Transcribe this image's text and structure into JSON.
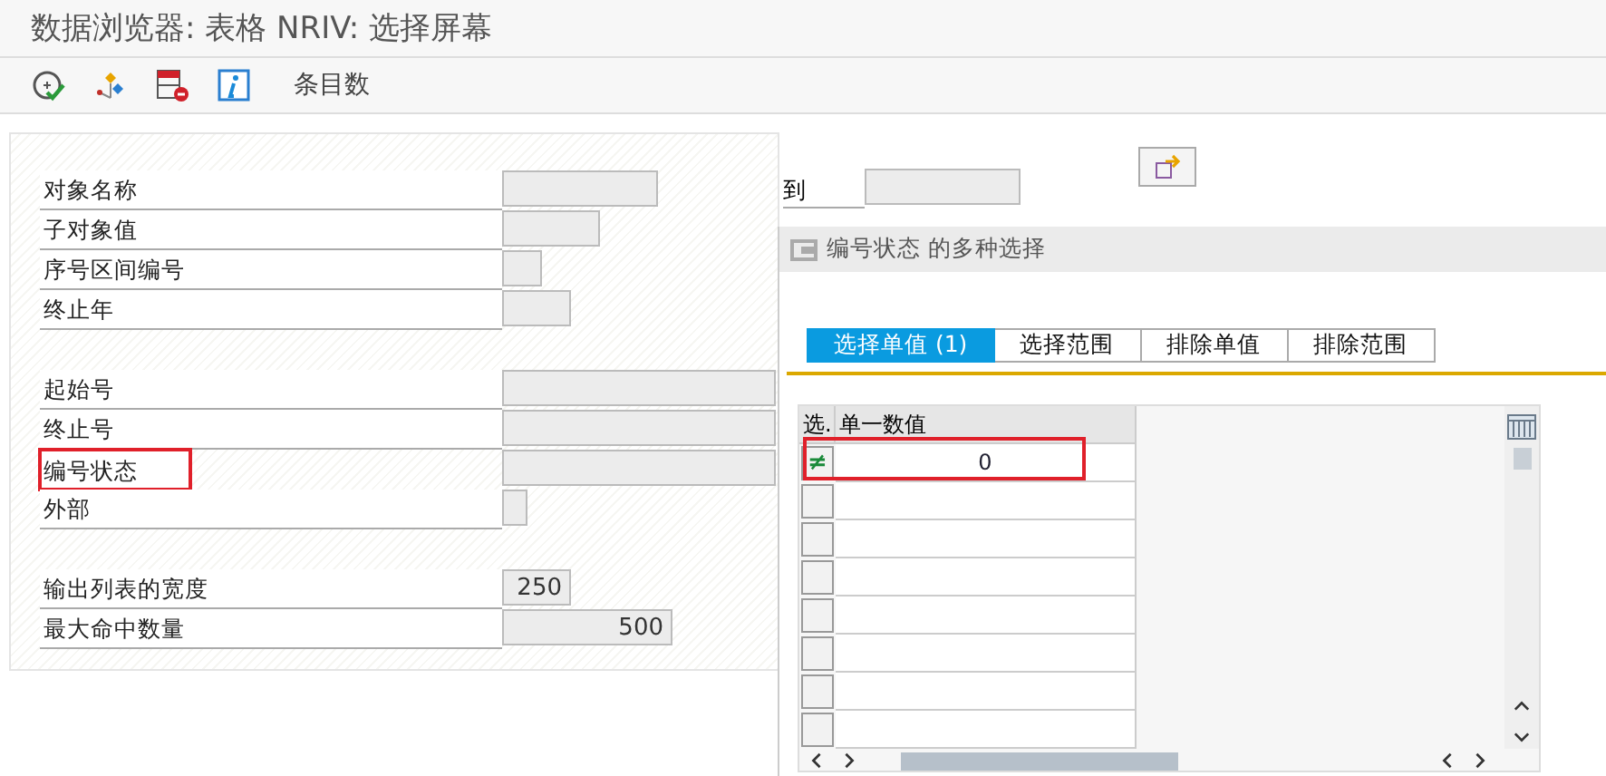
{
  "window": {
    "title": "数据浏览器: 表格 NRIV: 选择屏幕"
  },
  "toolbar": {
    "icons": [
      {
        "kind": "execute"
      },
      {
        "kind": "structure"
      },
      {
        "kind": "delete"
      },
      {
        "kind": "info"
      }
    ],
    "count_button": "条目数"
  },
  "form": {
    "groups": [
      [
        {
          "label": "对象名称",
          "highlighted": false
        },
        {
          "label": "子对象值",
          "highlighted": false
        },
        {
          "label": "序号区间编号",
          "highlighted": false
        },
        {
          "label": "终止年",
          "highlighted": false
        }
      ],
      [
        {
          "label": "起始号",
          "highlighted": false
        },
        {
          "label": "终止号",
          "highlighted": false
        },
        {
          "label": "编号状态",
          "highlighted": true
        },
        {
          "label": "外部",
          "highlighted": false
        }
      ],
      [
        {
          "label": "输出列表的宽度",
          "value": "250",
          "highlighted": false
        },
        {
          "label": "最大命中数量",
          "value": "500",
          "highlighted": false
        }
      ]
    ],
    "range_label": "到"
  },
  "dialog": {
    "title": "编号状态 的多种选择",
    "tabs": [
      {
        "label": "选择单值 (1)",
        "selected": true
      },
      {
        "label": "选择范围",
        "selected": false
      },
      {
        "label": "排除单值",
        "selected": false
      },
      {
        "label": "排除范围",
        "selected": false
      }
    ],
    "table": {
      "columns": [
        "选.",
        "单一数值"
      ],
      "rows": [
        {
          "option": "≠",
          "value": "0",
          "highlighted": true
        }
      ]
    }
  }
}
